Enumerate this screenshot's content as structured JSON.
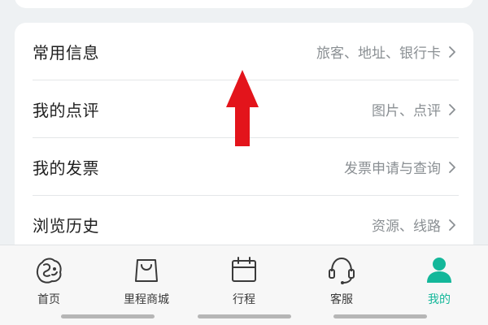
{
  "menu": {
    "rows": [
      {
        "title": "常用信息",
        "hint": "旅客、地址、银行卡"
      },
      {
        "title": "我的点评",
        "hint": "图片、点评"
      },
      {
        "title": "我的发票",
        "hint": "发票申请与查询"
      },
      {
        "title": "浏览历史",
        "hint": "资源、线路"
      }
    ]
  },
  "tabbar": {
    "tabs": [
      {
        "label": "首页",
        "icon": "home-icon"
      },
      {
        "label": "里程商城",
        "icon": "shopping-bag-icon"
      },
      {
        "label": "行程",
        "icon": "calendar-icon"
      },
      {
        "label": "客服",
        "icon": "headset-icon"
      },
      {
        "label": "我的",
        "icon": "profile-icon"
      }
    ],
    "active_index": 4
  },
  "colors": {
    "accent": "#14b79a",
    "annotation_arrow": "#e3141b"
  }
}
